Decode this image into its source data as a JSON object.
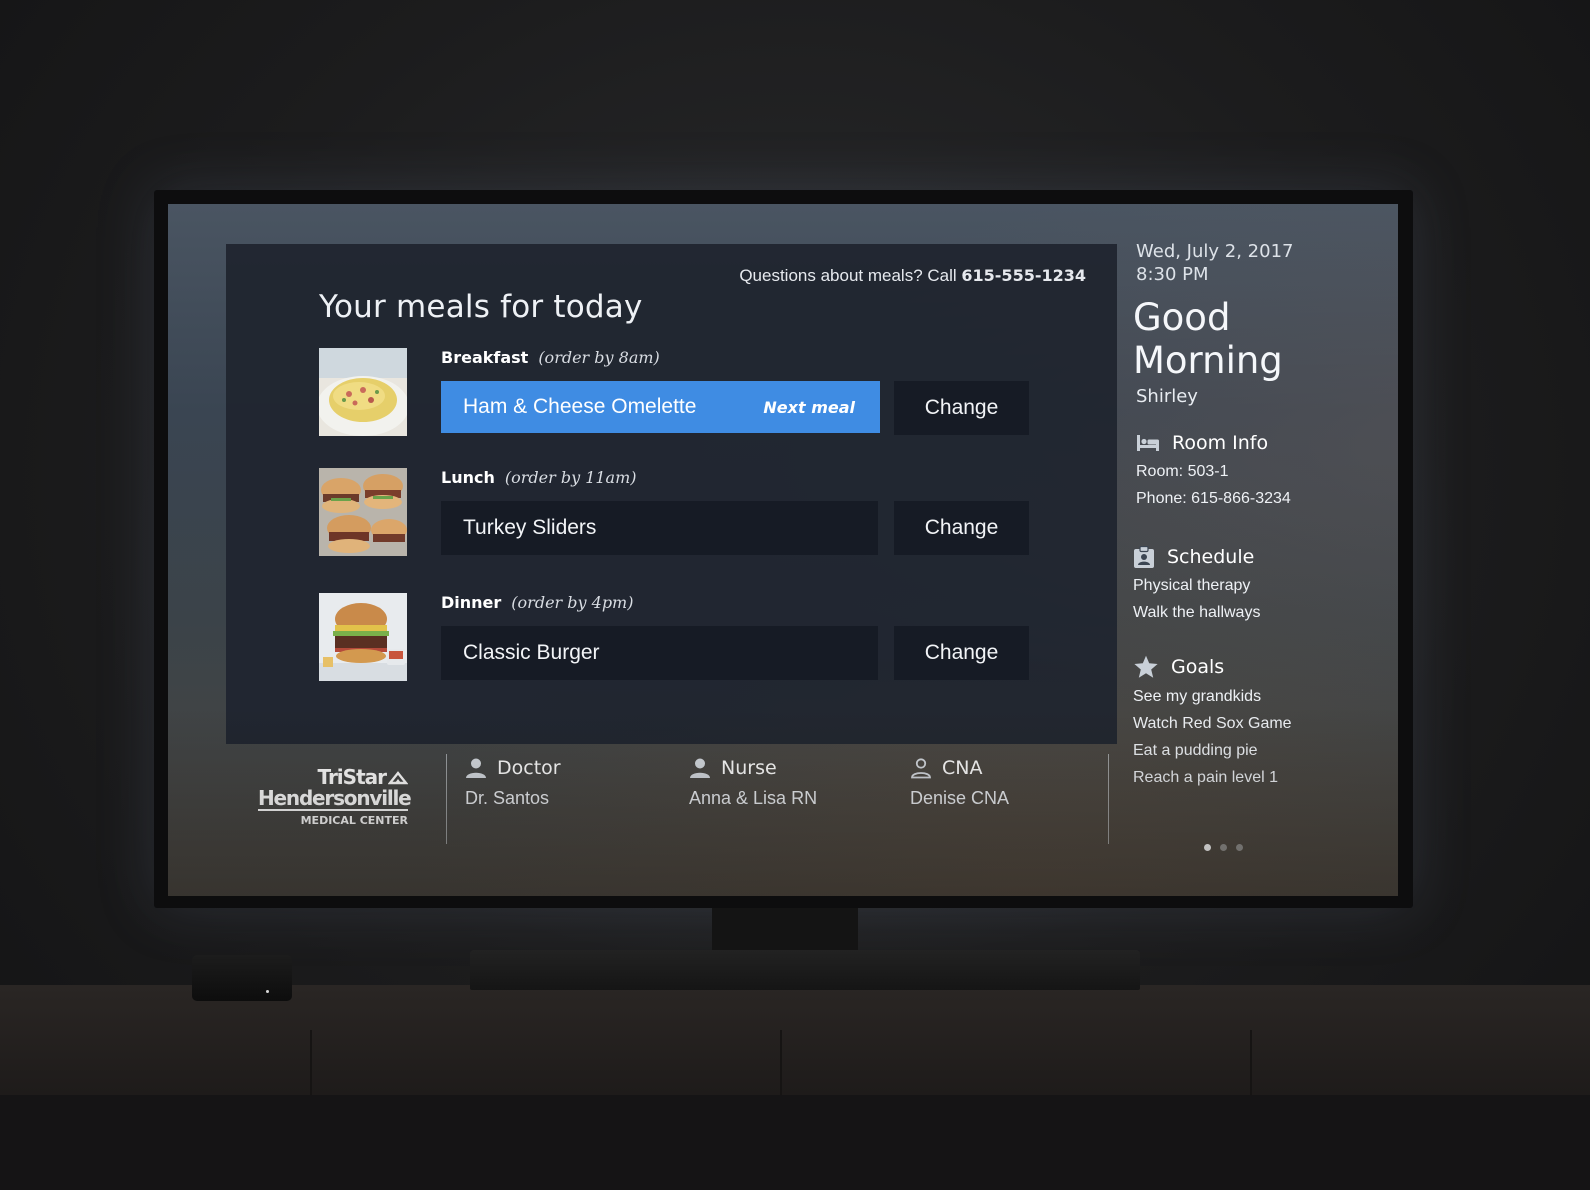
{
  "meals": {
    "questions_prefix": "Questions about meals? Call",
    "questions_phone": "615-555-1234",
    "title": "Your meals for today",
    "items": [
      {
        "type": "Breakfast",
        "deadline": "(order by 8am)",
        "choice": "Ham & Cheese Omelette",
        "badge": "Next meal",
        "action": "Change"
      },
      {
        "type": "Lunch",
        "deadline": "(order by 11am)",
        "choice": "Turkey Sliders",
        "action": "Change"
      },
      {
        "type": "Dinner",
        "deadline": "(order by 4pm)",
        "choice": "Classic Burger",
        "action": "Change"
      }
    ]
  },
  "logo": {
    "line1": "TriStar",
    "line2": "Hendersonville",
    "line3": "MEDICAL CENTER"
  },
  "care_team": [
    {
      "role": "Doctor",
      "name": "Dr. Santos",
      "icon": "person-icon"
    },
    {
      "role": "Nurse",
      "name": "Anna & Lisa RN",
      "icon": "person-icon"
    },
    {
      "role": "CNA",
      "name": "Denise CNA",
      "icon": "person-outline-icon"
    }
  ],
  "sidebar": {
    "date": "Wed, July 2, 2017",
    "time": "8:30 PM",
    "greeting_line1": "Good",
    "greeting_line2": "Morning",
    "patient_name": "Shirley",
    "room_info": {
      "title": "Room Info",
      "icon": "bed-icon",
      "room": "Room: 503-1",
      "phone": "Phone: 615-866-3234"
    },
    "schedule": {
      "title": "Schedule",
      "icon": "clipboard-icon",
      "items": [
        "Physical therapy",
        "Walk the hallways"
      ]
    },
    "goals": {
      "title": "Goals",
      "icon": "star-icon",
      "items": [
        "See my grandkids",
        "Watch Red Sox Game",
        "Eat a pudding pie",
        "Reach a pain level 1"
      ]
    }
  },
  "pager": {
    "pages": 3,
    "current": 1
  },
  "colors": {
    "accent": "#3f8ce3",
    "panel": "#202530",
    "field": "#161b25"
  }
}
